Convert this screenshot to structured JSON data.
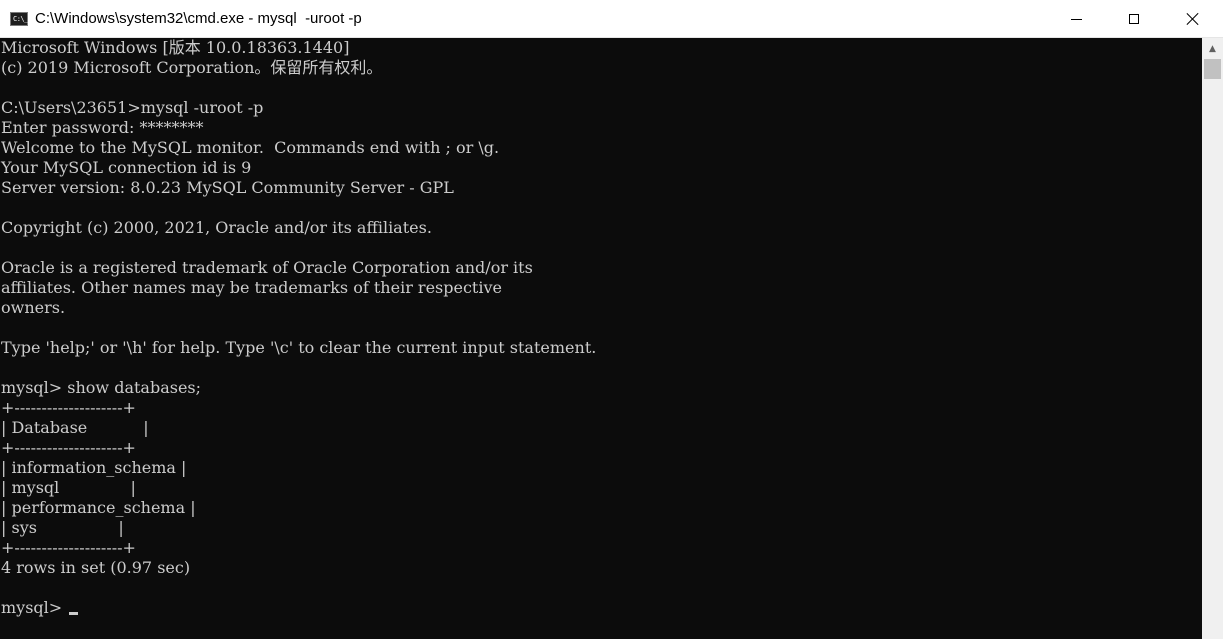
{
  "window": {
    "title": "C:\\Windows\\system32\\cmd.exe - mysql  -uroot -p",
    "icon_glyph": "C:\\_",
    "controls": {
      "minimize": "minimize-icon",
      "maximize": "maximize-icon",
      "close": "close-icon"
    }
  },
  "console": {
    "lines": [
      "Microsoft Windows [版本 10.0.18363.1440]",
      "(c) 2019 Microsoft Corporation。保留所有权利。",
      "",
      "C:\\Users\\23651>mysql -uroot -p",
      "Enter password: ********",
      "Welcome to the MySQL monitor.  Commands end with ; or \\g.",
      "Your MySQL connection id is 9",
      "Server version: 8.0.23 MySQL Community Server - GPL",
      "",
      "Copyright (c) 2000, 2021, Oracle and/or its affiliates.",
      "",
      "Oracle is a registered trademark of Oracle Corporation and/or its",
      "affiliates. Other names may be trademarks of their respective",
      "owners.",
      "",
      "Type 'help;' or '\\h' for help. Type '\\c' to clear the current input statement.",
      "",
      "mysql> show databases;",
      "+--------------------+",
      "| Database           |",
      "+--------------------+",
      "| information_schema |",
      "| mysql              |",
      "| performance_schema |",
      "| sys                |",
      "+--------------------+",
      "4 rows in set (0.97 sec)",
      "",
      "mysql> "
    ]
  },
  "scrollbar": {
    "up_arrow": "▲"
  }
}
